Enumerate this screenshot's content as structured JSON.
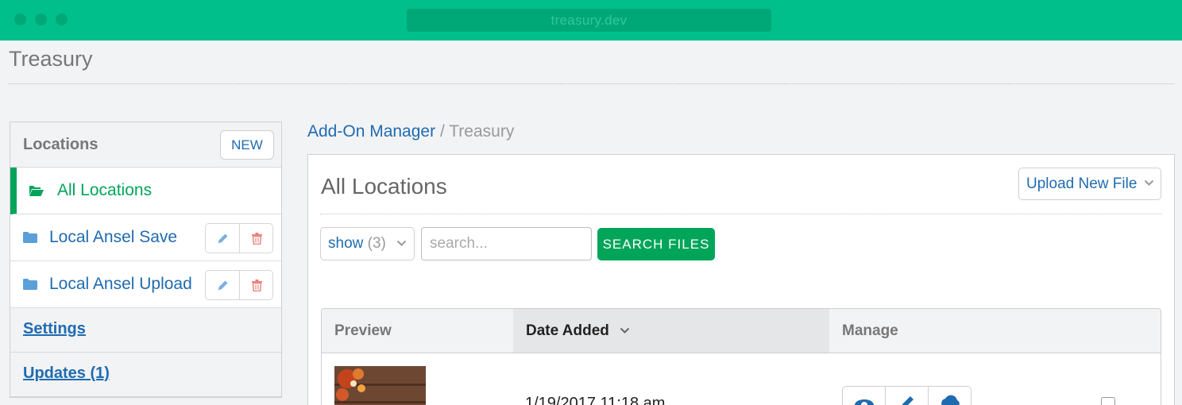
{
  "browser": {
    "url": "treasury.dev"
  },
  "page": {
    "title": "Treasury"
  },
  "sidebar": {
    "heading": "Locations",
    "new_label": "NEW",
    "locations": [
      {
        "label": "All Locations",
        "icon": "folder-open-icon",
        "active": true
      },
      {
        "label": "Local Ansel Save",
        "icon": "folder-icon",
        "active": false
      },
      {
        "label": "Local Ansel Upload",
        "icon": "folder-icon",
        "active": false
      }
    ],
    "links": [
      {
        "label": "Settings"
      },
      {
        "label": "Updates (1)"
      }
    ]
  },
  "breadcrumb": {
    "parent": "Add-On Manager",
    "separator": "/",
    "current": "Treasury"
  },
  "main": {
    "title": "All Locations",
    "upload_label": "Upload New File",
    "filter": {
      "show_label": "show",
      "show_count": "(3)"
    },
    "search": {
      "placeholder": "search...",
      "button_label": "SEARCH FILES"
    },
    "table": {
      "columns": [
        "Preview",
        "Date Added",
        "Manage"
      ],
      "sorted_column": "Date Added",
      "rows": [
        {
          "date": "1/19/2017 11:18 am",
          "checked": false
        }
      ]
    }
  },
  "colors": {
    "brand_green": "#00bf8a",
    "accent_green": "#00a55a",
    "link_blue": "#1f6bb0",
    "delete_red": "#e8807a",
    "folder_blue": "#5a9fd8"
  }
}
